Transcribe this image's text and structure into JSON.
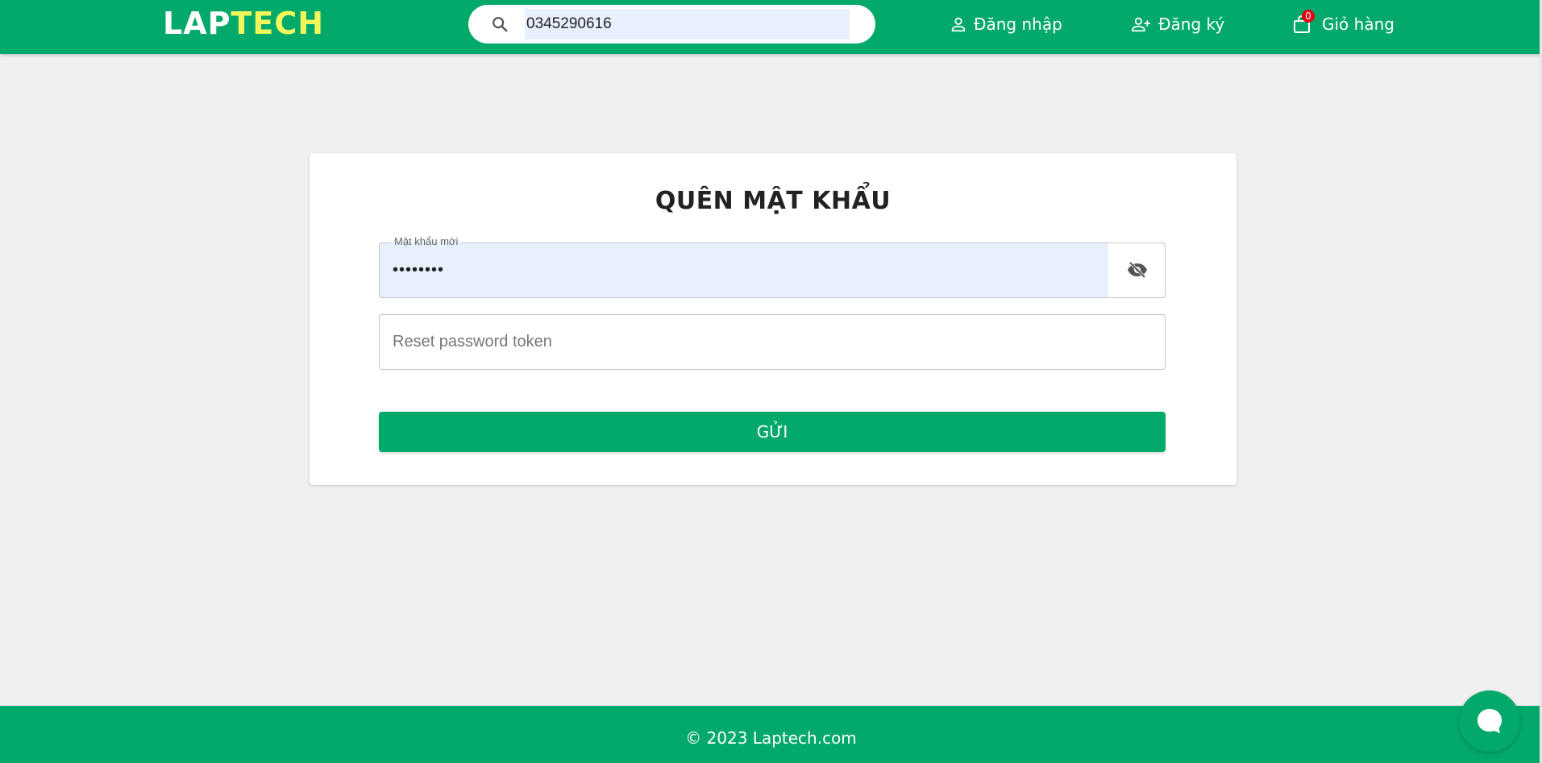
{
  "brand": {
    "part1": "LAP",
    "part2": "TECH"
  },
  "search": {
    "value": "0345290616",
    "icon": "search-icon"
  },
  "nav": {
    "login": {
      "label": "Đăng nhập",
      "icon": "user-icon"
    },
    "register": {
      "label": "Đăng ký",
      "icon": "user-add-icon"
    },
    "cart": {
      "label": "Giỏ hàng",
      "count": "0",
      "icon": "shopping-bag-icon"
    }
  },
  "form": {
    "title": "QUÊN MẬT KHẨU",
    "password": {
      "label": "Mật khẩu mới",
      "value": "••••••••",
      "toggle_icon": "eye-off-icon"
    },
    "token": {
      "placeholder": "Reset password token",
      "value": ""
    },
    "submit_label": "GỬI"
  },
  "footer": {
    "text": "© 2023 Laptech.com"
  },
  "chat": {
    "icon": "chat-bubble-icon"
  },
  "colors": {
    "primary": "#03a96b",
    "accent": "#f1f75a",
    "badge": "#e60012",
    "background": "#f0f0f0"
  }
}
